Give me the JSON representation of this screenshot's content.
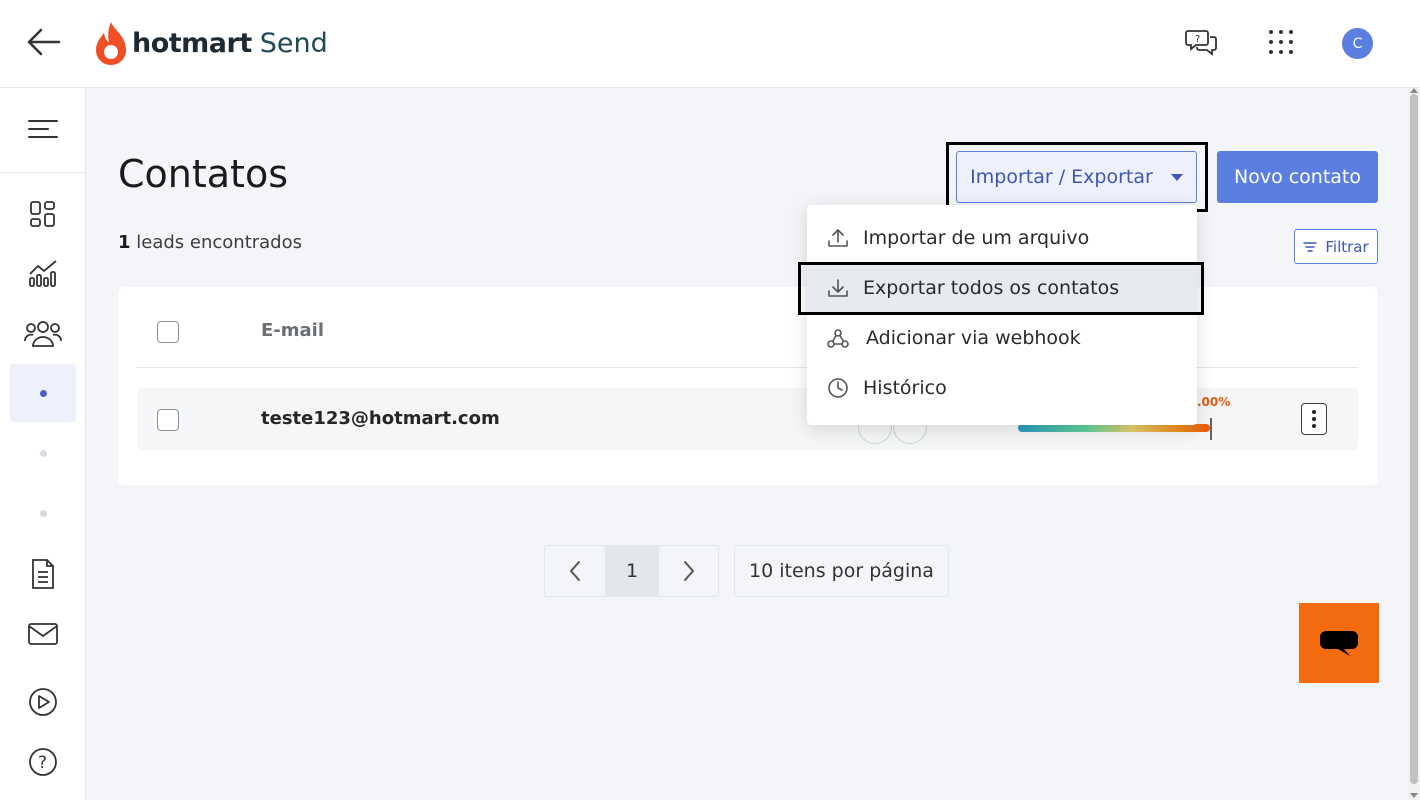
{
  "header": {
    "brand": "hotmart",
    "product": "Send",
    "avatar_initial": "C",
    "brand_color": "#f04e23"
  },
  "sidebar": {
    "items": [
      {
        "icon": "dashboard-icon"
      },
      {
        "icon": "analytics-icon"
      },
      {
        "icon": "contacts-icon"
      },
      {
        "icon": "dot-icon",
        "active": true
      },
      {
        "icon": "dot-icon"
      },
      {
        "icon": "dot-icon"
      },
      {
        "icon": "document-icon"
      },
      {
        "icon": "email-icon"
      },
      {
        "icon": "play-icon"
      },
      {
        "icon": "help-icon"
      }
    ]
  },
  "main": {
    "title": "Contatos",
    "leads_count": "1",
    "leads_label": "leads encontrados",
    "import_export_label": "Importar / Exportar",
    "new_contact_label": "Novo contato",
    "filter_label": "Filtrar",
    "table": {
      "columns": [
        "E-mail"
      ],
      "rows": [
        {
          "email": "teste123@hotmart.com",
          "score_text": ".00%"
        }
      ]
    }
  },
  "dropdown": {
    "items": [
      {
        "label": "Importar de um arquivo",
        "icon": "upload-icon"
      },
      {
        "label": "Exportar todos os contatos",
        "icon": "download-icon",
        "highlighted": true
      },
      {
        "label": "Adicionar via webhook",
        "icon": "webhook-icon"
      },
      {
        "label": "Histórico",
        "icon": "clock-icon"
      }
    ]
  },
  "pagination": {
    "current_page": "1",
    "per_page_label": "10 itens por página"
  },
  "colors": {
    "accent": "#5b7fe0",
    "chat_widget": "#f26b0f"
  }
}
